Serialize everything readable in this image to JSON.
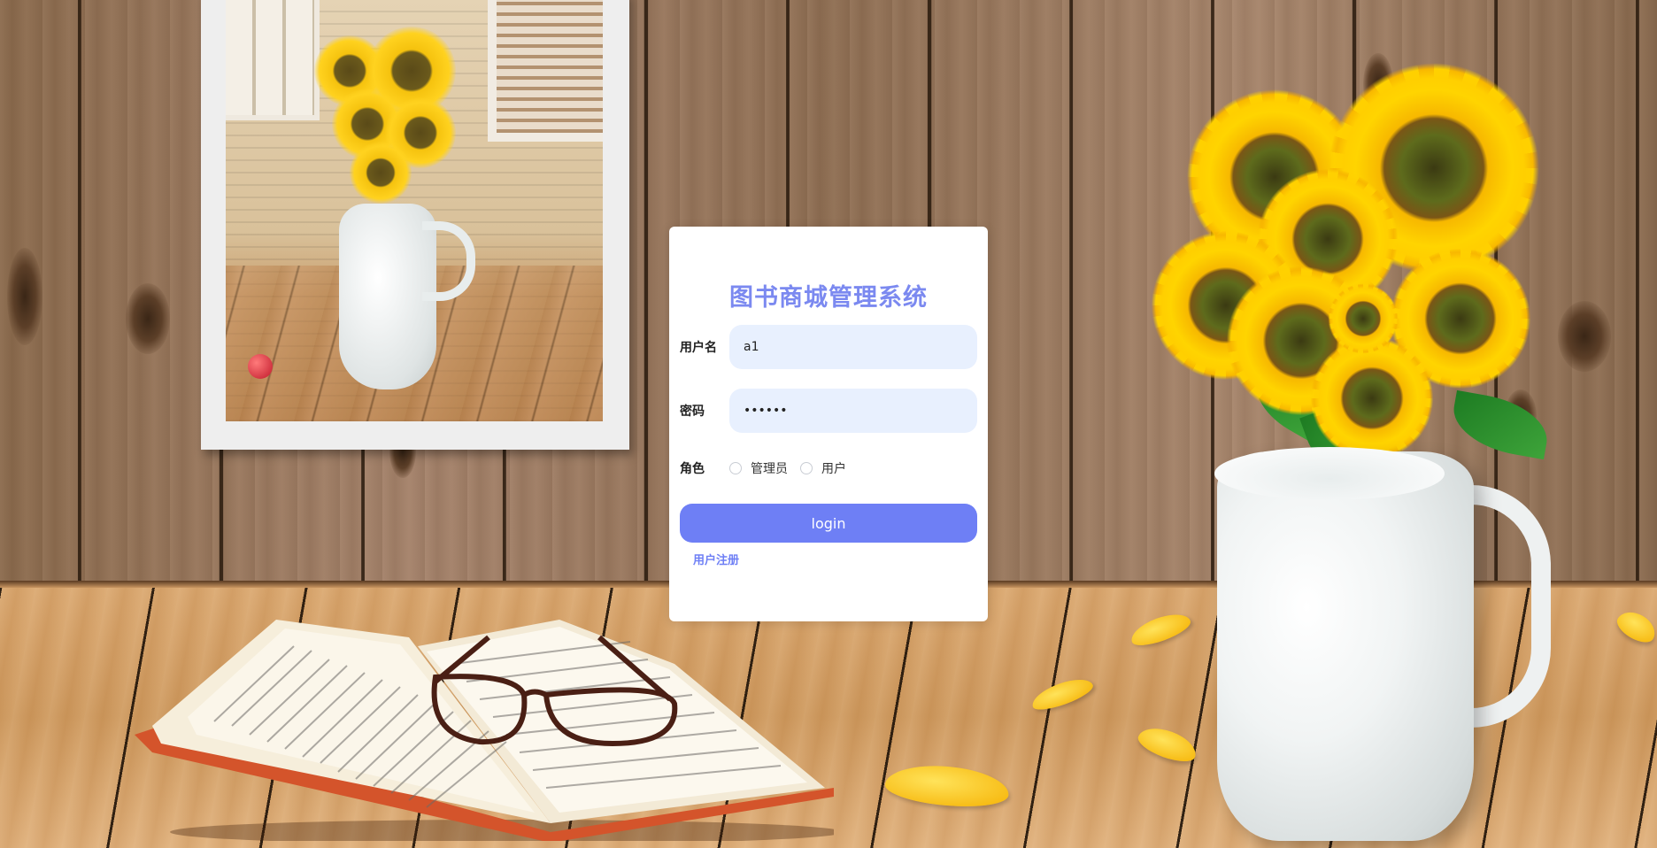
{
  "login": {
    "title": "图书商城管理系统",
    "username": {
      "label": "用户名",
      "value": "a1"
    },
    "password": {
      "label": "密码",
      "value": "••••••"
    },
    "role": {
      "label": "角色",
      "options": [
        "管理员",
        "用户"
      ],
      "selected": null
    },
    "submit_label": "login",
    "register_label": "用户注册"
  },
  "colors": {
    "title": "#7b89f0",
    "button": "#6e7ff5",
    "input_bg": "#e8f0fe"
  },
  "icons": [
    "radio-unchecked-icon"
  ]
}
